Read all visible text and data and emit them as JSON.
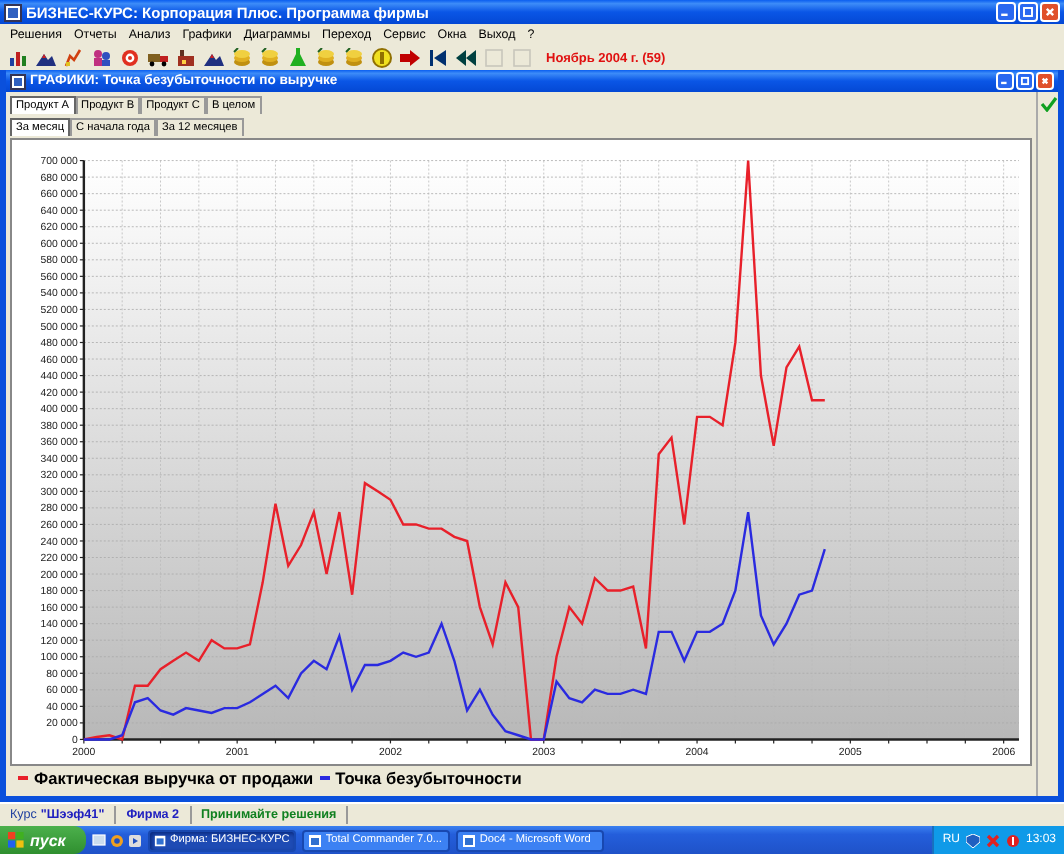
{
  "window": {
    "title": "БИЗНЕС-КУРС: Корпорация Плюс. Программа фирмы"
  },
  "menu": [
    "Решения",
    "Отчеты",
    "Анализ",
    "Графики",
    "Диаграммы",
    "Переход",
    "Сервис",
    "Окна",
    "Выход",
    "?"
  ],
  "toolbar": {
    "buttons": [
      {
        "kind": "chart",
        "disabled": false
      },
      {
        "kind": "mountain",
        "disabled": false
      },
      {
        "kind": "graph",
        "disabled": false
      },
      {
        "kind": "people",
        "disabled": false
      },
      {
        "kind": "target",
        "disabled": false
      },
      {
        "kind": "truck",
        "disabled": false
      },
      {
        "kind": "factory",
        "disabled": false
      },
      {
        "kind": "mountain",
        "disabled": false
      },
      {
        "kind": "stack",
        "disabled": false
      },
      {
        "kind": "stack",
        "disabled": false
      },
      {
        "kind": "flask",
        "disabled": false
      },
      {
        "kind": "stack",
        "disabled": false
      },
      {
        "kind": "stack",
        "disabled": false
      },
      {
        "kind": "coin",
        "disabled": false
      },
      {
        "kind": "arrow",
        "disabled": false
      },
      {
        "kind": "first",
        "disabled": false
      },
      {
        "kind": "rewind",
        "disabled": false
      },
      {
        "kind": "square",
        "disabled": true
      },
      {
        "kind": "square",
        "disabled": true
      }
    ],
    "period": "Ноябрь 2004 г. (59)"
  },
  "chart_window": {
    "title": "ГРАФИКИ: Точка безубыточности по выручке",
    "tabs": [
      {
        "label": "Продукт А",
        "selected": true
      },
      {
        "label": "Продукт В",
        "selected": false
      },
      {
        "label": "Продукт С",
        "selected": false
      },
      {
        "label": "В целом",
        "selected": false
      }
    ],
    "subtabs": [
      {
        "label": "За месяц",
        "selected": true
      },
      {
        "label": "С начала года",
        "selected": false
      },
      {
        "label": "За 12 месяцев",
        "selected": false
      }
    ],
    "chart_data": {
      "type": "line",
      "x": [
        2000,
        2000.083,
        2000.167,
        2000.25,
        2000.333,
        2000.417,
        2000.5,
        2000.583,
        2000.667,
        2000.75,
        2000.833,
        2000.917,
        2001,
        2001.083,
        2001.167,
        2001.25,
        2001.333,
        2001.417,
        2001.5,
        2001.583,
        2001.667,
        2001.75,
        2001.833,
        2001.917,
        2002,
        2002.083,
        2002.167,
        2002.25,
        2002.333,
        2002.417,
        2002.5,
        2002.583,
        2002.667,
        2002.75,
        2002.833,
        2002.917,
        2003,
        2003.083,
        2003.167,
        2003.25,
        2003.333,
        2003.417,
        2003.5,
        2003.583,
        2003.667,
        2003.75,
        2003.833,
        2003.917,
        2004,
        2004.083,
        2004.167,
        2004.25,
        2004.333,
        2004.417,
        2004.5,
        2004.583,
        2004.667,
        2004.75,
        2004.833
      ],
      "series": [
        {
          "name": "Фактическая выручка от продажи",
          "color": "#e8202a",
          "values": [
            0,
            3000,
            5000,
            0,
            65000,
            65000,
            85000,
            95000,
            105000,
            95000,
            120000,
            110000,
            110000,
            115000,
            190000,
            285000,
            210000,
            235000,
            275000,
            200000,
            275000,
            175000,
            310000,
            300000,
            290000,
            260000,
            260000,
            255000,
            255000,
            245000,
            240000,
            160000,
            115000,
            190000,
            160000,
            0,
            0,
            100000,
            160000,
            140000,
            195000,
            180000,
            180000,
            185000,
            110000,
            345000,
            365000,
            260000,
            390000,
            390000,
            380000,
            480000,
            700000,
            440000,
            355000,
            450000,
            475000,
            410000,
            410000
          ]
        },
        {
          "name": "Точка безубыточности",
          "color": "#2a2ae0",
          "values": [
            0,
            0,
            0,
            5000,
            45000,
            50000,
            35000,
            30000,
            38000,
            35000,
            32000,
            38000,
            38000,
            45000,
            55000,
            65000,
            50000,
            80000,
            95000,
            85000,
            125000,
            60000,
            90000,
            90000,
            95000,
            105000,
            100000,
            105000,
            140000,
            95000,
            35000,
            60000,
            30000,
            10000,
            5000,
            0,
            0,
            70000,
            50000,
            45000,
            60000,
            55000,
            55000,
            60000,
            55000,
            130000,
            130000,
            95000,
            130000,
            130000,
            140000,
            180000,
            275000,
            150000,
            115000,
            140000,
            175000,
            180000,
            230000
          ]
        }
      ],
      "grid": true,
      "xlim": [
        2000,
        2006.1
      ],
      "ylim": [
        0,
        700000
      ],
      "xticks": [
        2000,
        2001,
        2002,
        2003,
        2004,
        2005,
        2006
      ],
      "yticks": [
        {
          "value": 0,
          "label": "0"
        },
        {
          "value": 20000,
          "label": "20 000"
        },
        {
          "value": 40000,
          "label": "40 000"
        },
        {
          "value": 60000,
          "label": "60 000"
        },
        {
          "value": 80000,
          "label": "80 000"
        },
        {
          "value": 100000,
          "label": "100 000"
        },
        {
          "value": 120000,
          "label": "120 000"
        },
        {
          "value": 140000,
          "label": "140 000"
        },
        {
          "value": 160000,
          "label": "160 000"
        },
        {
          "value": 180000,
          "label": "180 000"
        },
        {
          "value": 200000,
          "label": "200 000"
        },
        {
          "value": 220000,
          "label": "220 000"
        },
        {
          "value": 240000,
          "label": "240 000"
        },
        {
          "value": 260000,
          "label": "260 000"
        },
        {
          "value": 280000,
          "label": "280 000"
        },
        {
          "value": 300000,
          "label": "300 000"
        },
        {
          "value": 320000,
          "label": "320 000"
        },
        {
          "value": 340000,
          "label": "340 000"
        },
        {
          "value": 360000,
          "label": "360 000"
        },
        {
          "value": 380000,
          "label": "380 000"
        },
        {
          "value": 400000,
          "label": "400 000"
        },
        {
          "value": 420000,
          "label": "420 000"
        },
        {
          "value": 440000,
          "label": "440 000"
        },
        {
          "value": 460000,
          "label": "460 000"
        },
        {
          "value": 480000,
          "label": "480 000"
        },
        {
          "value": 500000,
          "label": "500 000"
        },
        {
          "value": 520000,
          "label": "520 000"
        },
        {
          "value": 540000,
          "label": "540 000"
        },
        {
          "value": 560000,
          "label": "560 000"
        },
        {
          "value": 580000,
          "label": "580 000"
        },
        {
          "value": 600000,
          "label": "600 000"
        },
        {
          "value": 620000,
          "label": "620 000"
        },
        {
          "value": 640000,
          "label": "640 000"
        },
        {
          "value": 660000,
          "label": "660 000"
        },
        {
          "value": 680000,
          "label": "680 000"
        },
        {
          "value": 700000,
          "label": "700 000"
        }
      ]
    }
  },
  "status_bar": {
    "items": [
      {
        "kind": "course",
        "label": "Курс",
        "value": "\"Шээф41\""
      },
      {
        "kind": "firm",
        "value": "Фирма 2"
      },
      {
        "kind": "hint",
        "value": "Принимайте решения"
      }
    ]
  },
  "taskbar": {
    "start": "пуск",
    "tasks": [
      {
        "label": "Фирма: БИЗНЕС-КУРС",
        "selected": true
      },
      {
        "label": "Total Commander 7.0...",
        "selected": false
      },
      {
        "label": "Doc4 - Microsoft Word",
        "selected": false
      }
    ],
    "language": "RU",
    "clock": "13:03"
  }
}
